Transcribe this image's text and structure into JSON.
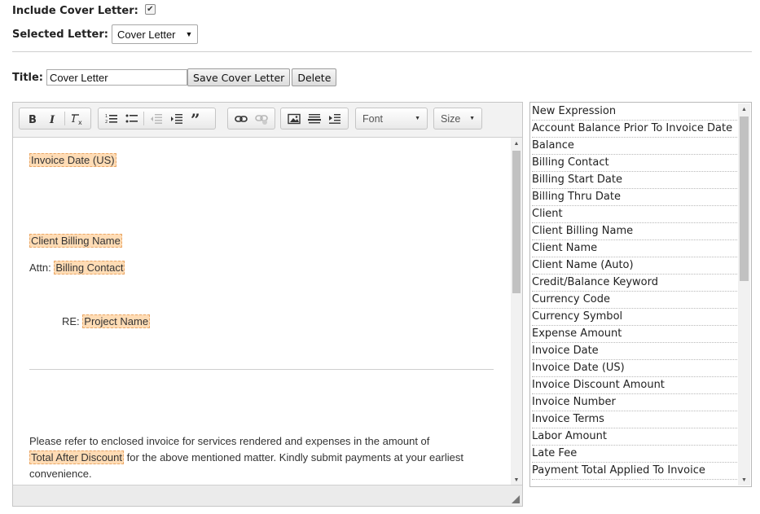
{
  "form": {
    "include_label": "Include Cover Letter:",
    "include_checked": true,
    "selected_label": "Selected Letter:",
    "selected_value": "Cover Letter",
    "title_label": "Title:",
    "title_value": "Cover Letter",
    "save_button": "Save Cover Letter",
    "delete_button": "Delete"
  },
  "toolbar": {
    "font_combo": "Font",
    "size_combo": "Size"
  },
  "letter": {
    "invoice_date": "Invoice Date (US)",
    "client_billing_name": "Client Billing Name",
    "attn_prefix": "Attn: ",
    "billing_contact": "Billing Contact",
    "re_prefix": "RE: ",
    "project_name": "Project Name",
    "para1_text": "Please refer to enclosed invoice for services rendered and expenses in the amount of",
    "total_after_discount": "Total After Discount",
    "para2_text": " for the above mentioned matter. Kindly submit payments at your earliest",
    "para3_text": "convenience."
  },
  "expressions": [
    "New Expression",
    "Account Balance Prior To Invoice Date",
    "Balance",
    "Billing Contact",
    "Billing Start Date",
    "Billing Thru Date",
    "Client",
    "Client Billing Name",
    "Client Name",
    "Client Name (Auto)",
    "Credit/Balance Keyword",
    "Currency Code",
    "Currency Symbol",
    "Expense Amount",
    "Invoice Date",
    "Invoice Date (US)",
    "Invoice Discount Amount",
    "Invoice Number",
    "Invoice Terms",
    "Labor Amount",
    "Late Fee",
    "Payment Total Applied To Invoice"
  ],
  "colors": {
    "placeholder_bg": "#ffdcb5",
    "placeholder_border": "#e9a767"
  }
}
